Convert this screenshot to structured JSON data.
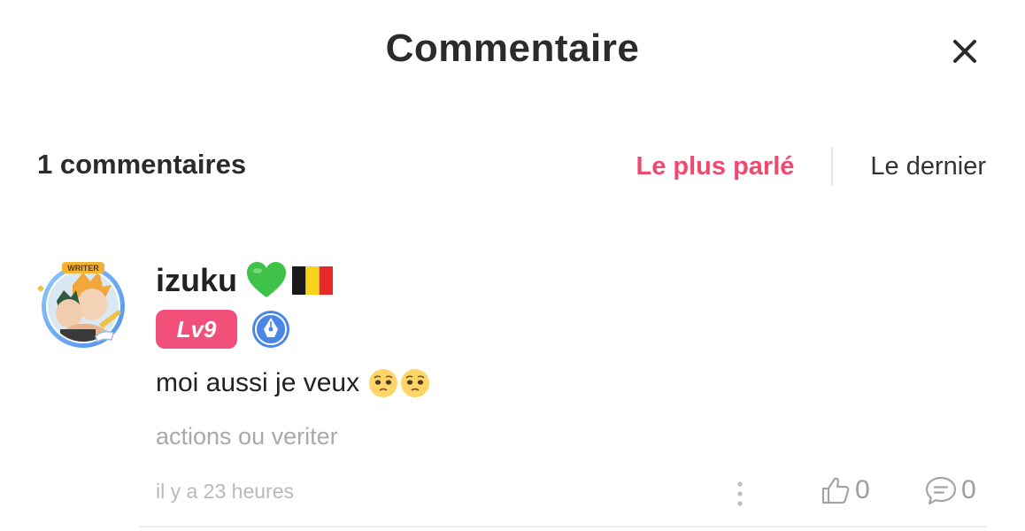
{
  "header": {
    "title": "Commentaire"
  },
  "comments_header": {
    "count_label": "1 commentaires",
    "sort_options": [
      "Le plus parlé",
      "Le dernier"
    ],
    "active_sort": "Le plus parlé"
  },
  "comment": {
    "username": "izuku",
    "username_icons": [
      "green-heart-icon",
      "belgium-flag-icon"
    ],
    "avatar_badge_text": "WRITER",
    "level_label": "Lv9",
    "badge_icon": "pen-nib-badge-icon",
    "text": "moi aussi je veux",
    "text_emojis": [
      "pleading-face-icon",
      "pleading-face-icon"
    ],
    "topic": "actions ou veriter",
    "time": "il y a 23 heures",
    "like_count": "0",
    "reply_count": "0"
  },
  "colors": {
    "accent": "#ee4a6f",
    "level_badge": "#f0507a",
    "muted_text": "#a9a9a9",
    "title_text": "#2b2b2b"
  }
}
